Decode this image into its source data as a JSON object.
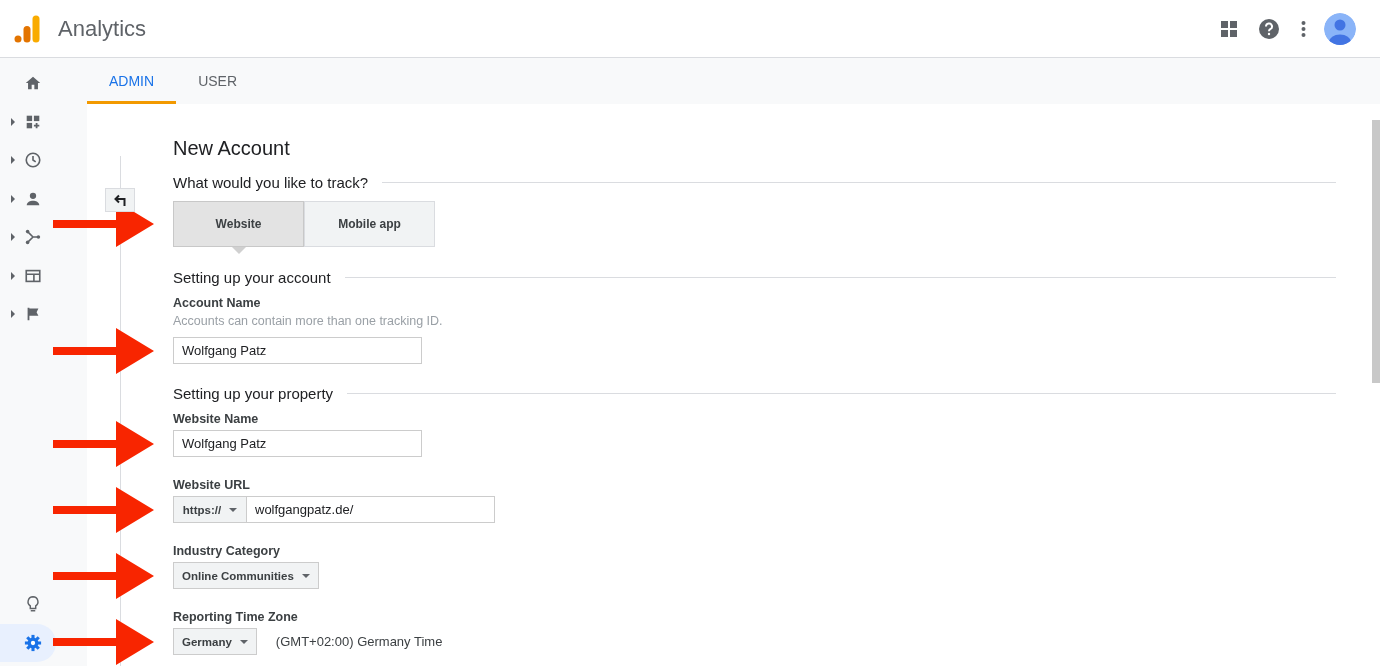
{
  "app": {
    "title": "Analytics"
  },
  "sidebar": {
    "items": [
      {
        "expandable": false,
        "selected": false
      },
      {
        "expandable": true,
        "selected": false
      },
      {
        "expandable": true,
        "selected": false
      },
      {
        "expandable": true,
        "selected": false
      },
      {
        "expandable": true,
        "selected": false
      },
      {
        "expandable": true,
        "selected": false
      },
      {
        "expandable": true,
        "selected": false
      }
    ],
    "bottom_items": [
      {
        "selected": false
      },
      {
        "selected": true
      }
    ]
  },
  "tabs": [
    {
      "label": "ADMIN",
      "selected": true
    },
    {
      "label": "USER",
      "selected": false
    }
  ],
  "form": {
    "title": "New Account",
    "track": {
      "heading": "What would you like to track?",
      "marked": true,
      "options": [
        {
          "label": "Website",
          "selected": true
        },
        {
          "label": "Mobile app",
          "selected": false
        }
      ]
    },
    "account": {
      "heading": "Setting up your account",
      "label": "Account Name",
      "hint": "Accounts can contain more than one tracking ID.",
      "value": "Wolfgang Patz",
      "marked": true
    },
    "property": {
      "heading": "Setting up your property",
      "website_name": {
        "label": "Website Name",
        "value": "Wolfgang Patz",
        "marked": true
      },
      "website_url": {
        "label": "Website URL",
        "protocol": "https://",
        "value": "wolfgangpatz.de/",
        "marked": true
      },
      "industry": {
        "label": "Industry Category",
        "value": "Online Communities",
        "marked": true
      },
      "time_zone": {
        "label": "Reporting Time Zone",
        "value": "Germany",
        "description": "(GMT+02:00) Germany Time",
        "marked": true
      }
    }
  }
}
